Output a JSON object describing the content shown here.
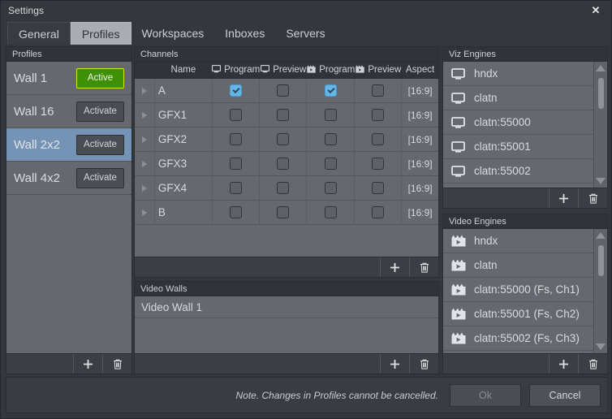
{
  "window": {
    "title": "Settings",
    "close_icon": "close-icon"
  },
  "tabs": [
    {
      "label": "General",
      "state": "bordered"
    },
    {
      "label": "Profiles",
      "state": "active"
    },
    {
      "label": "Workspaces",
      "state": "plain"
    },
    {
      "label": "Inboxes",
      "state": "plain"
    },
    {
      "label": "Servers",
      "state": "plain"
    }
  ],
  "profiles": {
    "header": "Profiles",
    "rows": [
      {
        "name": "Wall 1",
        "button": "Active",
        "is_active": true,
        "selected": false
      },
      {
        "name": "Wall 16",
        "button": "Activate",
        "is_active": false,
        "selected": false
      },
      {
        "name": "Wall 2x2",
        "button": "Activate",
        "is_active": false,
        "selected": true
      },
      {
        "name": "Wall 4x2",
        "button": "Activate",
        "is_active": false,
        "selected": false
      }
    ],
    "add_icon": "plus-icon",
    "delete_icon": "trash-icon"
  },
  "channels": {
    "header": "Channels",
    "columns": [
      {
        "label": "Name",
        "icon": ""
      },
      {
        "label": "Program",
        "icon": "monitor-icon"
      },
      {
        "label": "Preview",
        "icon": "monitor-icon"
      },
      {
        "label": "Program",
        "icon": "clapperboard-icon"
      },
      {
        "label": "Preview",
        "icon": "clapperboard-icon"
      },
      {
        "label": "Aspect",
        "icon": ""
      }
    ],
    "rows": [
      {
        "name": "A",
        "viz_program": true,
        "viz_preview": false,
        "video_program": true,
        "video_preview": false,
        "aspect": "[16:9]"
      },
      {
        "name": "GFX1",
        "viz_program": false,
        "viz_preview": false,
        "video_program": false,
        "video_preview": false,
        "aspect": "[16:9]"
      },
      {
        "name": "GFX2",
        "viz_program": false,
        "viz_preview": false,
        "video_program": false,
        "video_preview": false,
        "aspect": "[16:9]"
      },
      {
        "name": "GFX3",
        "viz_program": false,
        "viz_preview": false,
        "video_program": false,
        "video_preview": false,
        "aspect": "[16:9]"
      },
      {
        "name": "GFX4",
        "viz_program": false,
        "viz_preview": false,
        "video_program": false,
        "video_preview": false,
        "aspect": "[16:9]"
      },
      {
        "name": "B",
        "viz_program": false,
        "viz_preview": false,
        "video_program": false,
        "video_preview": false,
        "aspect": "[16:9]"
      }
    ],
    "expand_icon": "expand-triangle-icon",
    "add_icon": "plus-icon",
    "delete_icon": "trash-icon"
  },
  "video_walls": {
    "header": "Video Walls",
    "rows": [
      {
        "name": "Video Wall 1"
      }
    ],
    "add_icon": "plus-icon",
    "delete_icon": "trash-icon"
  },
  "viz_engines": {
    "header": "Viz Engines",
    "rows": [
      {
        "name": "hndx",
        "icon": "monitor-icon"
      },
      {
        "name": "clatn",
        "icon": "monitor-icon"
      },
      {
        "name": "clatn:55000",
        "icon": "monitor-icon"
      },
      {
        "name": "clatn:55001",
        "icon": "monitor-icon"
      },
      {
        "name": "clatn:55002",
        "icon": "monitor-icon"
      }
    ],
    "scroll": {
      "up_icon": "scroll-up-arrow-icon",
      "down_icon": "scroll-down-arrow-icon"
    },
    "add_icon": "plus-icon",
    "delete_icon": "trash-icon"
  },
  "video_engines": {
    "header": "Video Engines",
    "rows": [
      {
        "name": "hndx",
        "icon": "clapperboard-icon"
      },
      {
        "name": "clatn",
        "icon": "clapperboard-icon"
      },
      {
        "name": "clatn:55000 (Fs, Ch1)",
        "icon": "clapperboard-icon"
      },
      {
        "name": "clatn:55001 (Fs, Ch2)",
        "icon": "clapperboard-icon"
      },
      {
        "name": "clatn:55002 (Fs, Ch3)",
        "icon": "clapperboard-icon"
      }
    ],
    "scroll": {
      "up_icon": "scroll-up-arrow-icon",
      "down_icon": "scroll-down-arrow-icon"
    },
    "add_icon": "plus-icon",
    "delete_icon": "trash-icon"
  },
  "footer": {
    "note": "Note. Changes in Profiles cannot be cancelled.",
    "ok_label": "Ok",
    "ok_disabled": true,
    "cancel_label": "Cancel"
  },
  "colors": {
    "window_bg": "#34383c",
    "panel_bg": "#3a3e43",
    "list_bg": "#65696d",
    "selection": "#7593b4",
    "active_green": "#3e9104",
    "active_border": "#d9e40c",
    "checkbox_on": "#64b5e8",
    "text": "#d6dade"
  }
}
